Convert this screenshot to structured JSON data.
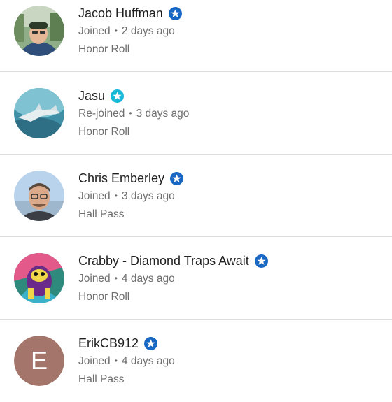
{
  "members": [
    {
      "name": "Jacob Huffman",
      "badge_color": "#1767c3",
      "status": "Joined",
      "separator": "•",
      "time": "2 days ago",
      "level": "Honor Roll",
      "avatar_icon": "photo-avatar"
    },
    {
      "name": "Jasu",
      "badge_color": "#19b8d6",
      "status": "Re-joined",
      "separator": "•",
      "time": "3 days ago",
      "level": "Honor Roll",
      "avatar_icon": "photo-avatar"
    },
    {
      "name": "Chris Emberley",
      "badge_color": "#1767c3",
      "status": "Joined",
      "separator": "•",
      "time": "3 days ago",
      "level": "Hall Pass",
      "avatar_icon": "photo-avatar"
    },
    {
      "name": "Crabby - Diamond Traps Await",
      "badge_color": "#1767c3",
      "status": "Joined",
      "separator": "•",
      "time": "4 days ago",
      "level": "Honor Roll",
      "avatar_icon": "photo-avatar"
    },
    {
      "name": "ErikCB912",
      "badge_color": "#1767c3",
      "status": "Joined",
      "separator": "•",
      "time": "4 days ago",
      "level": "Hall Pass",
      "avatar_letter": "E",
      "avatar_color": "#a3756b"
    }
  ]
}
